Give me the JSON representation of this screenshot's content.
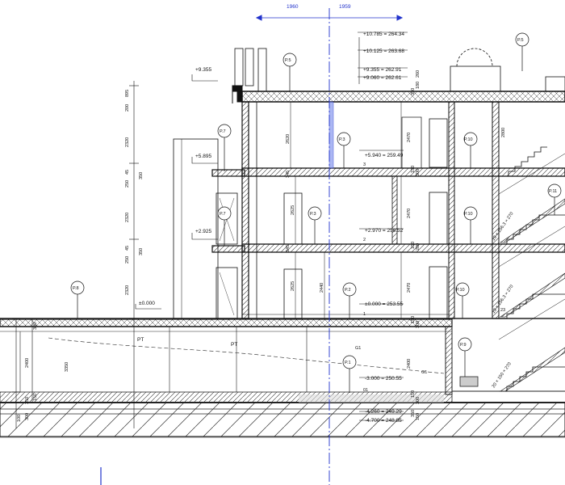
{
  "header_dims": {
    "left": "1960",
    "right": "1959"
  },
  "elevations": {
    "e1": {
      "a": "+10.785",
      "b": "264.34"
    },
    "e2": {
      "a": "+10.125",
      "b": "263.68"
    },
    "e3": {
      "a": "+9.355",
      "b": "262.91"
    },
    "e4": {
      "a": "+9.060",
      "b": "262.61"
    },
    "e5": {
      "a": "+5.940",
      "b": "259.49"
    },
    "e6": {
      "a": "+2.970",
      "b": "256.52"
    },
    "e7": {
      "a": "±0.000",
      "b": "253.55"
    },
    "e8": {
      "a": "-3.000",
      "b": "250.55"
    },
    "e9": {
      "a": "-4.260",
      "b": "249.29"
    },
    "e10": {
      "a": "-4.700",
      "b": "248.85"
    }
  },
  "left_levels": {
    "l1": "+9.355",
    "l2": "+5.895",
    "l3": "+2.925",
    "l4": "±0.000"
  },
  "tags": {
    "p1": "P.1",
    "p2": "P.2",
    "p3": "P.3",
    "p5": "P.5",
    "p7": "P.7",
    "p8": "P.8",
    "p9": "P.9",
    "p10": "P.10",
    "p11": "P.11"
  },
  "floor_marks": {
    "f1": "1",
    "f2": "2",
    "f3": "3",
    "f01": "01",
    "f23": "23"
  },
  "labels": {
    "pt1": "PT",
    "pt2": "PT",
    "g1": "G1",
    "g2": "G1"
  },
  "left_dims": {
    "d1": "200",
    "d2": "895",
    "d3": "2320",
    "d4": "250",
    "d5": "45",
    "d6": "350",
    "d7": "2320",
    "d8": "250",
    "d9": "45",
    "d10": "350",
    "d11": "2320",
    "d12": "300",
    "d13": "2400",
    "d14": "3350",
    "d15": "150",
    "d16": "350",
    "d17": "100",
    "d18": "300"
  },
  "inner_dims": {
    "h1": "2620",
    "h2": "2625",
    "h3": "2625",
    "h4": "2440",
    "h5": "345",
    "h6": "345",
    "h7": "2470",
    "h8": "2470",
    "h9": "2470",
    "h10": "2400",
    "h11": "2800"
  },
  "right_dims": {
    "r1": "350",
    "r2": "180",
    "r3": "260",
    "r4": "150",
    "r5": "300",
    "r6": "150",
    "r7": "200",
    "r8": "150",
    "r9": "300",
    "r10": "150",
    "r11": "300",
    "r12": "350",
    "r13": "150"
  },
  "stairs": {
    "s1": "19 × 156.3 × 270",
    "s2": "19 × 156.3 × 270",
    "s3": "20 × 150 × 270"
  }
}
